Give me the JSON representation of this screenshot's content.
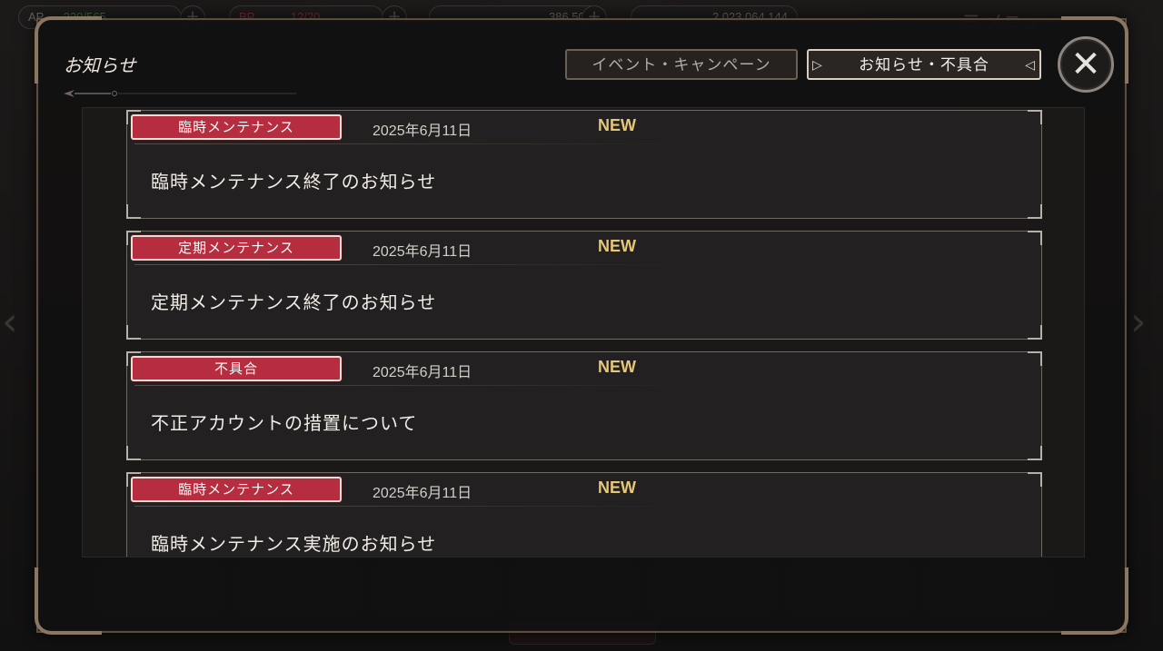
{
  "background": {
    "resources": [
      {
        "label": "AP",
        "value": "229/565"
      },
      {
        "label": "BP",
        "value": "12/20"
      },
      {
        "label": "",
        "value": "386,506"
      },
      {
        "label": "",
        "value": "2,023,064,144"
      }
    ],
    "menu_label": "メニュー",
    "bottom_buttons": [
      "",
      "",
      "",
      "",
      "",
      "",
      ""
    ],
    "bottom_label": ""
  },
  "dialog": {
    "title": "お知らせ",
    "tabs": [
      {
        "label": "イベント・キャンペーン",
        "active": false
      },
      {
        "label": "お知らせ・不具合",
        "active": true
      }
    ],
    "close_label": "✕"
  },
  "notices": [
    {
      "tag": "臨時メンテナンス",
      "date": "2025年6月11日",
      "badge": "NEW",
      "title": "臨時メンテナンス終了のお知らせ"
    },
    {
      "tag": "定期メンテナンス",
      "date": "2025年6月11日",
      "badge": "NEW",
      "title": "定期メンテナンス終了のお知らせ"
    },
    {
      "tag": "不具合",
      "date": "2025年6月11日",
      "badge": "NEW",
      "title": "不正アカウントの措置について"
    },
    {
      "tag": "臨時メンテナンス",
      "date": "2025年6月11日",
      "badge": "NEW",
      "title": "臨時メンテナンス実施のお知らせ"
    }
  ],
  "colors": {
    "tag_red": "#b52d3e",
    "new_gold": "#e6c779",
    "frame_gold": "#8a7761"
  }
}
